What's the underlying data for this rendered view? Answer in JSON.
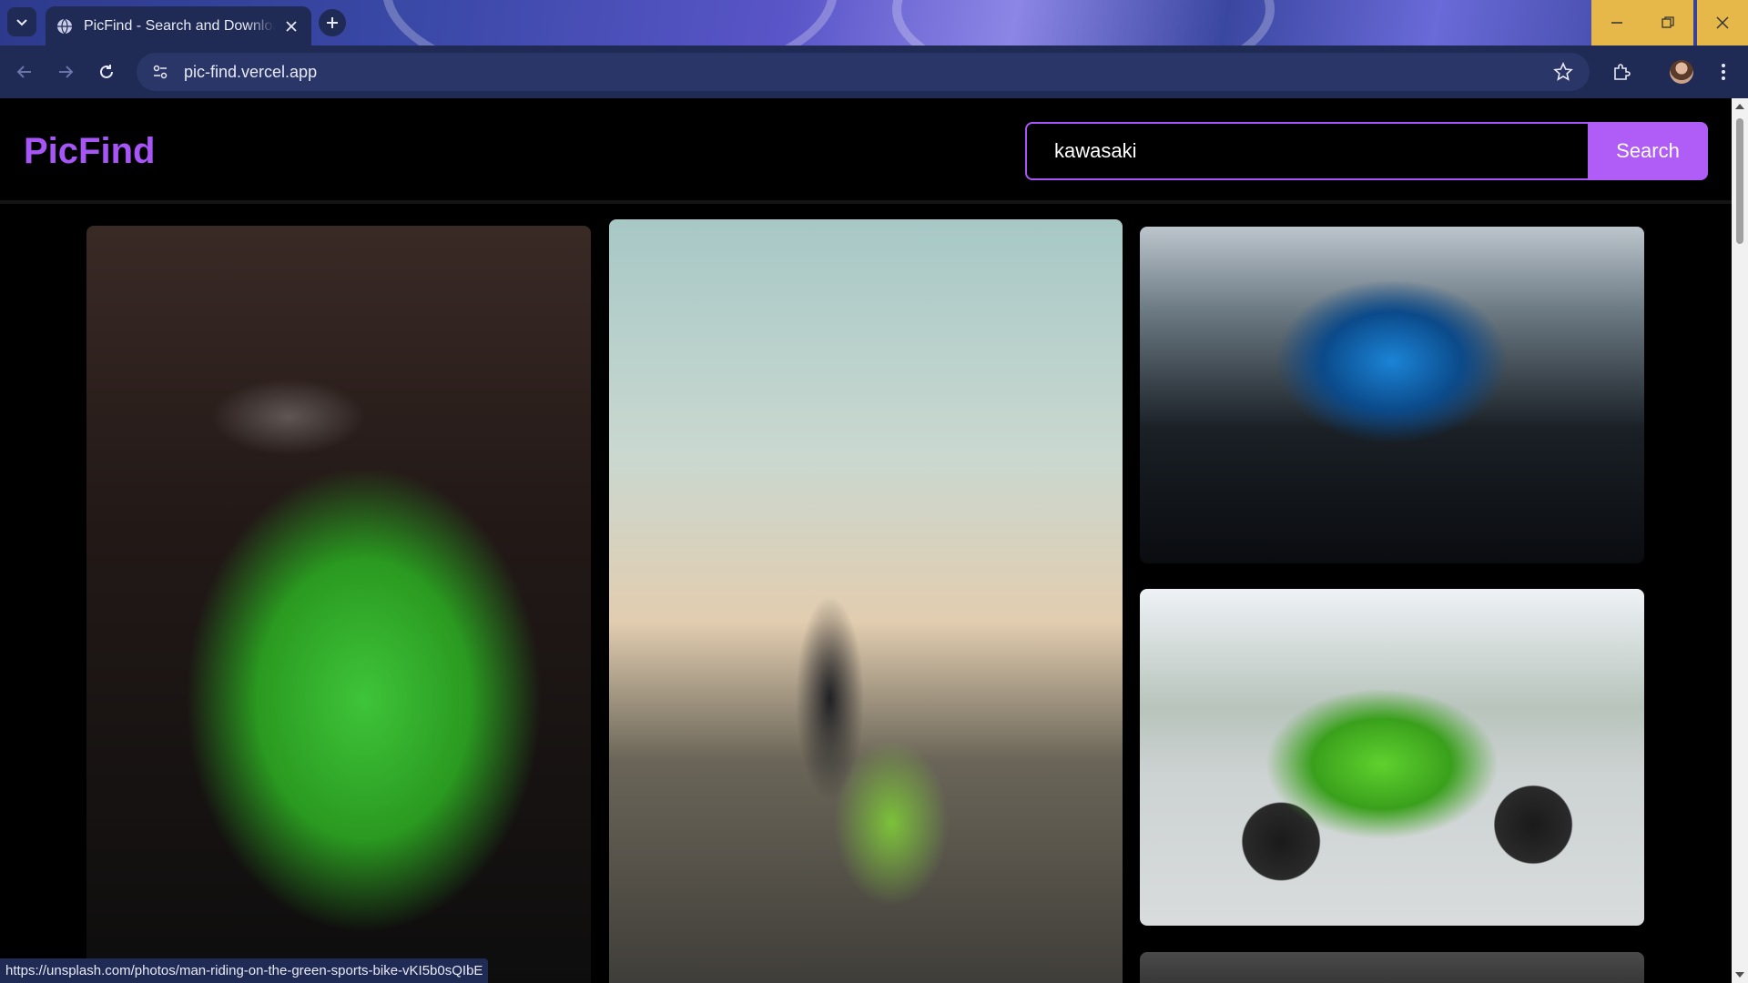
{
  "browser": {
    "tab_title": "PicFind - Search and Download",
    "url": "pic-find.vercel.app",
    "status_url": "https://unsplash.com/photos/man-riding-on-the-green-sports-bike-vKI5b0sQIbE"
  },
  "app": {
    "logo": "PicFind",
    "search_value": "kawasaki",
    "search_button": "Search",
    "accent_color": "#a855f7"
  },
  "photos": [
    {
      "subject": "green Kawasaki Ninja 400 parked at night"
    },
    {
      "subject": "man riding on the green sports bike"
    },
    {
      "subject": "blue Kawasaki motorcycle close-up"
    },
    {
      "subject": "green Kawasaki Ninja sport bike on pavement"
    },
    {
      "subject": "partially visible photo"
    }
  ]
}
